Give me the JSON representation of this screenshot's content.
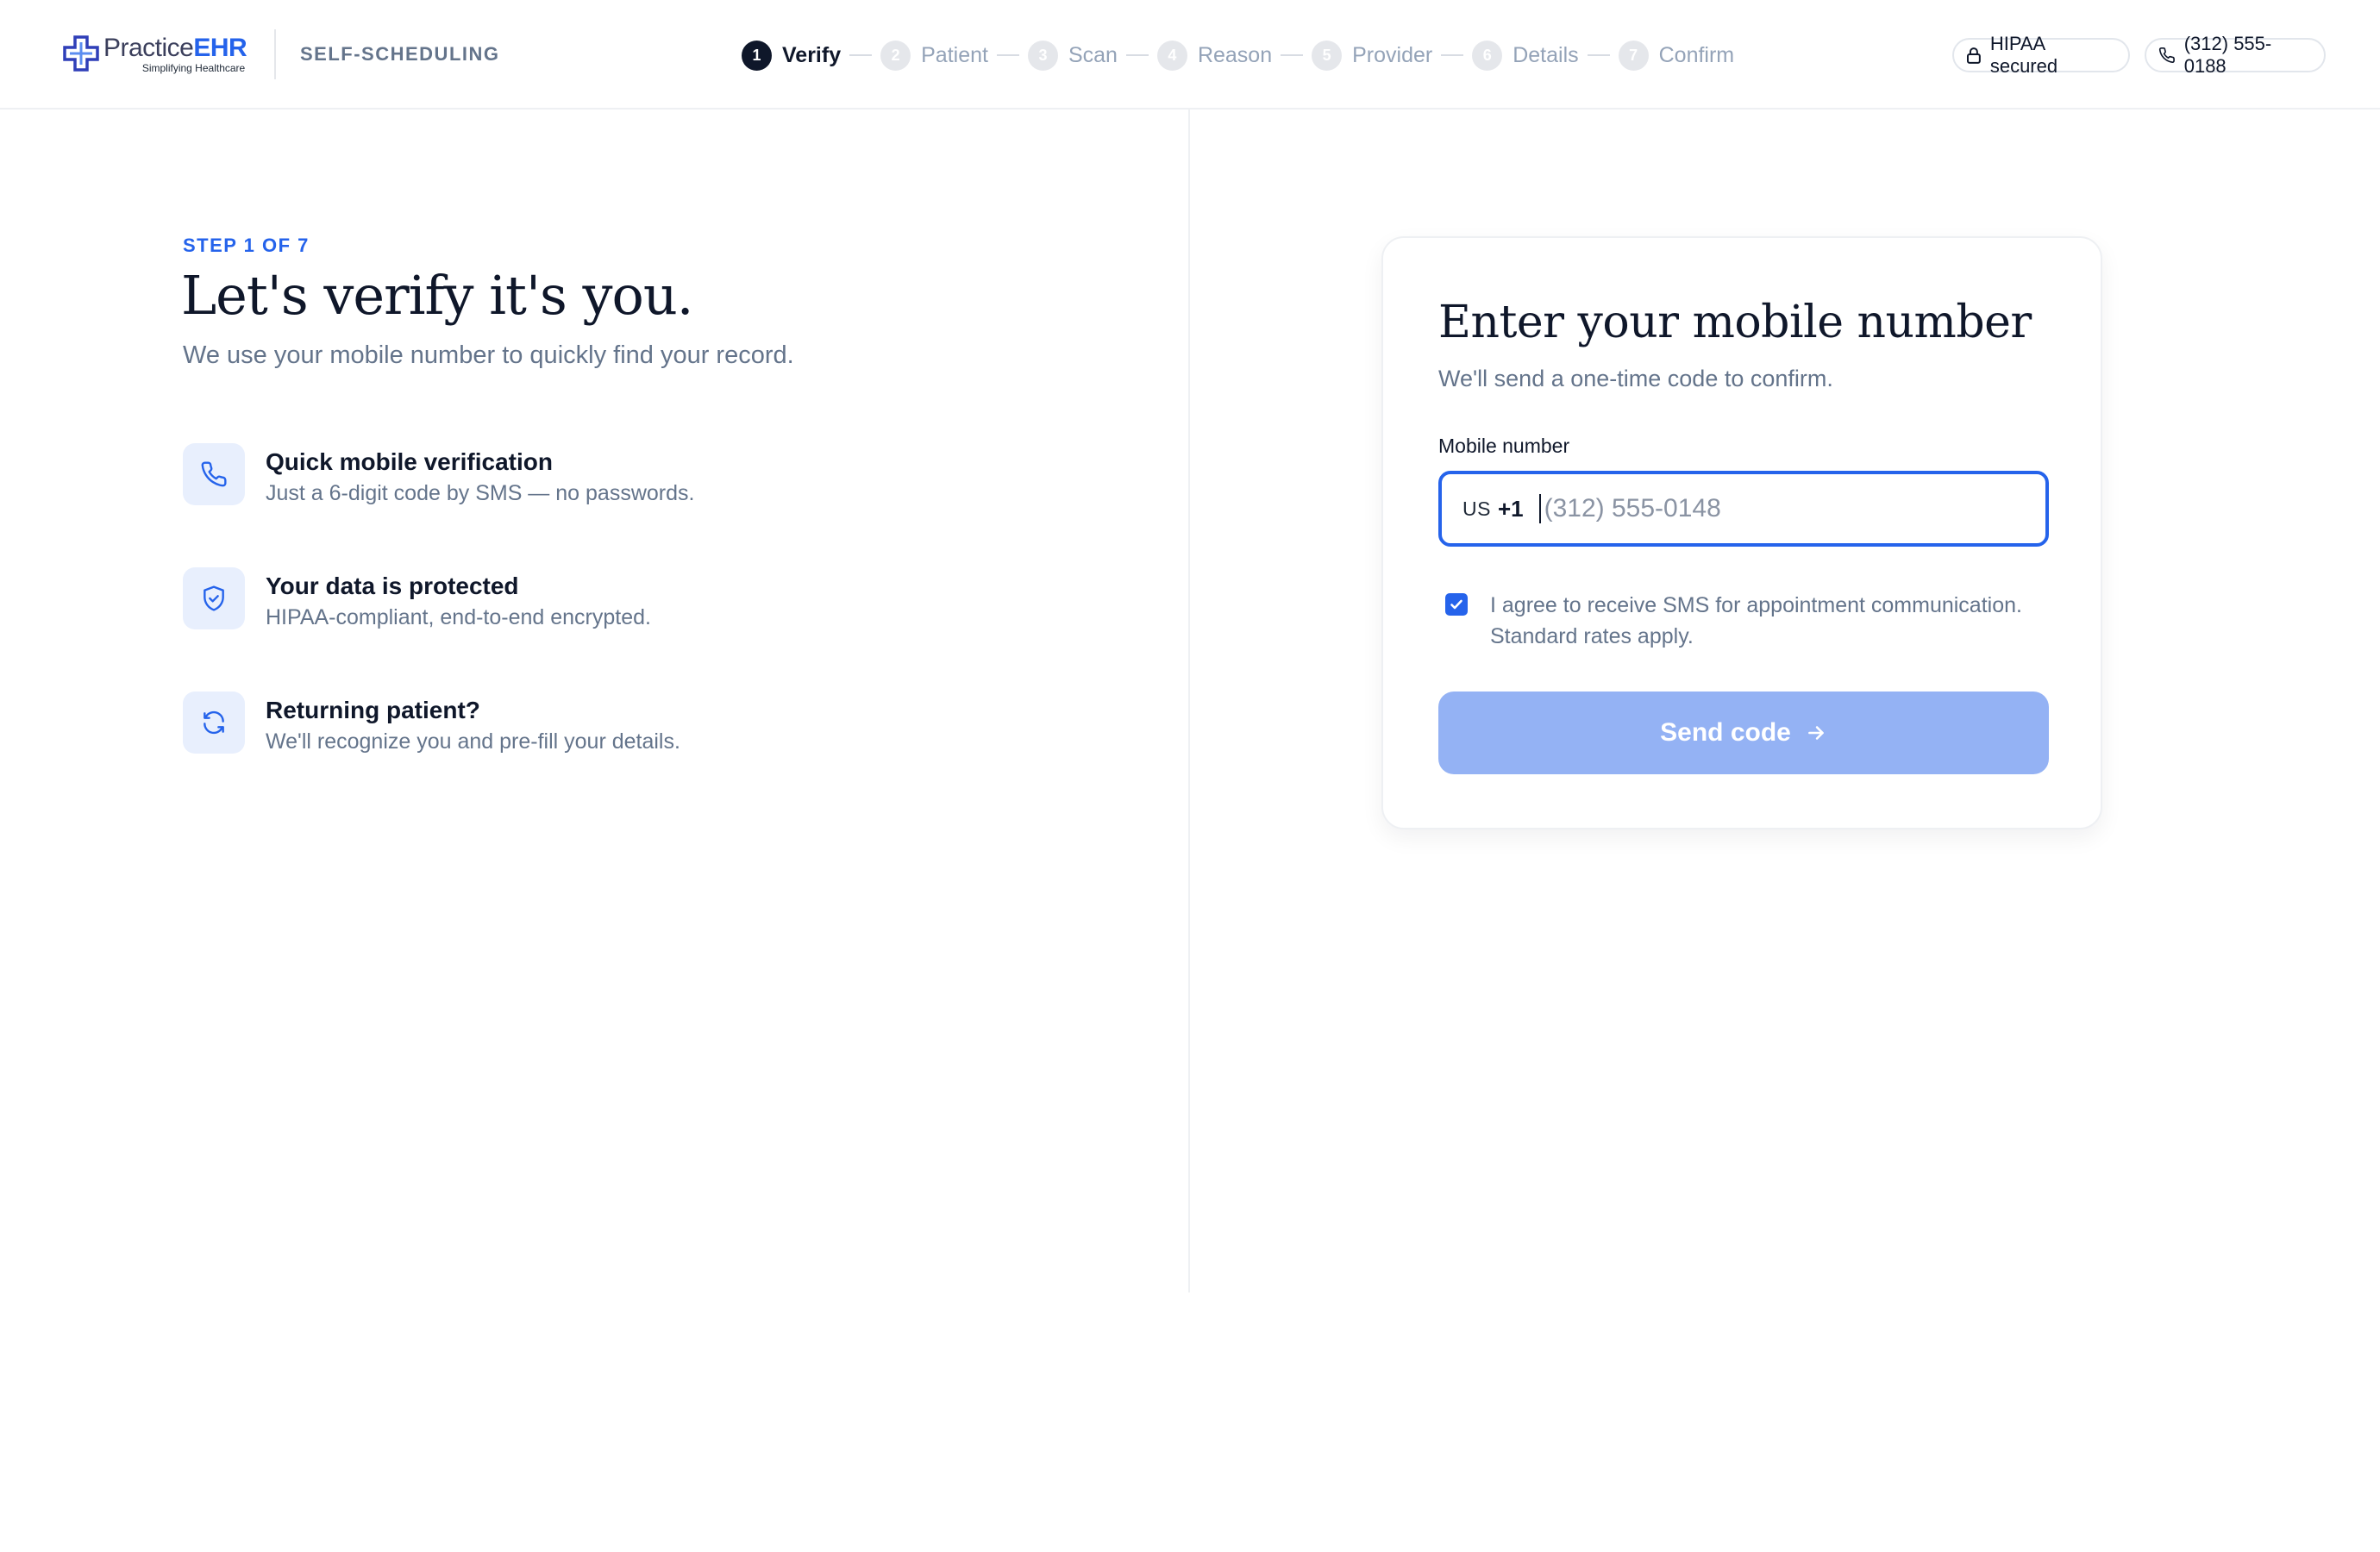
{
  "header": {
    "logo": {
      "name_part1": "Practice",
      "name_part2": "EHR",
      "tagline": "Simplifying Healthcare"
    },
    "section": "SELF-SCHEDULING",
    "steps": [
      {
        "num": "1",
        "label": "Verify",
        "active": true
      },
      {
        "num": "2",
        "label": "Patient"
      },
      {
        "num": "3",
        "label": "Scan"
      },
      {
        "num": "4",
        "label": "Reason"
      },
      {
        "num": "5",
        "label": "Provider"
      },
      {
        "num": "6",
        "label": "Details"
      },
      {
        "num": "7",
        "label": "Confirm"
      }
    ],
    "hipaa_label": "HIPAA secured",
    "phone": "(312) 555-0188"
  },
  "intro": {
    "eyebrow": "STEP 1 OF 7",
    "title": "Let's verify it's you.",
    "subtitle": "We use your mobile number to quickly find your record.",
    "features": [
      {
        "icon": "phone-icon",
        "title": "Quick mobile verification",
        "desc": "Just a 6-digit code by SMS — no passwords."
      },
      {
        "icon": "shield-icon",
        "title": "Your data is protected",
        "desc": "HIPAA-compliant, end-to-end encrypted."
      },
      {
        "icon": "refresh-icon",
        "title": "Returning patient?",
        "desc": "We'll recognize you and pre-fill your details."
      }
    ]
  },
  "card": {
    "title": "Enter your mobile number",
    "subtitle": "We'll send a one-time code to confirm.",
    "field_label": "Mobile number",
    "country_code": "US",
    "dial_code": "+1",
    "phone_value": "",
    "phone_placeholder": "(312) 555-0148",
    "consent_checked": true,
    "consent_text": "I agree to receive SMS for appointment communication. Standard rates apply.",
    "send_label": "Send code"
  },
  "colors": {
    "accent": "#2563eb",
    "button_disabled": "#94b2f4",
    "muted": "#64748b",
    "ink": "#0f172a"
  }
}
